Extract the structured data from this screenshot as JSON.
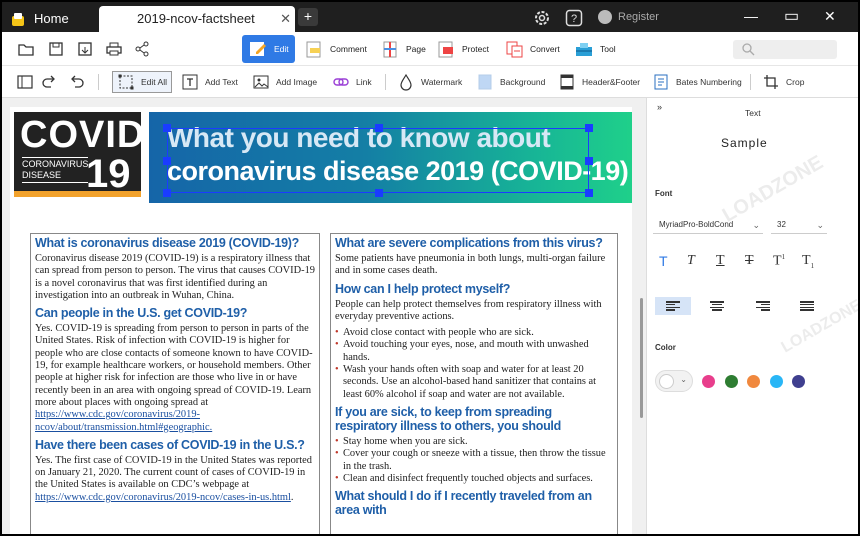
{
  "titlebar": {
    "home_tab": "Home",
    "doc_tab": "2019-ncov-factsheet",
    "close": "✕",
    "add": "+",
    "register": "Register",
    "minimize": "—",
    "maximize": "▭",
    "window_close": "✕"
  },
  "toolbar": {
    "tools": [
      "Edit",
      "Comment",
      "Page",
      "Protect",
      "Convert",
      "Tool"
    ]
  },
  "edit_toolbar": {
    "items": [
      "Edit All",
      "Add Text",
      "Add Image",
      "Link",
      "Watermark",
      "Background",
      "Header&Footer",
      "Bates Numbering",
      "Crop"
    ]
  },
  "document": {
    "logo_covid": "COVID",
    "logo_corona": "CORONAVIRUS",
    "logo_disease": "DISEASE",
    "logo_19": "19",
    "banner_line1": "What you need to know about",
    "banner_line2": "coronavirus disease 2019 (COVID-19)",
    "left": {
      "h1": "What is coronavirus disease 2019 (COVID-19)?",
      "p1": "Coronavirus disease 2019 (COVID-19) is a respiratory illness that can spread from person to person. The virus that causes COVID-19 is a novel coronavirus that was first identified during an investigation into an outbreak in Wuhan, China.",
      "h2": "Can people in the U.S. get COVID-19?",
      "p2": "Yes. COVID-19 is spreading from person to person in parts of the United States. Risk of infection with COVID-19 is higher for people who are close contacts of someone known to have COVID-19, for example healthcare workers, or household members. Other people at higher risk for infection are those who live in or have recently been in an area with ongoing spread of COVID-19. Learn more about places with ongoing spread at",
      "link1": "https://www.cdc.gov/coronavirus/2019-ncov/about/transmission.html#geographic.",
      "h3": "Have there been cases of COVID-19 in the U.S.?",
      "p3": "Yes. The first case of COVID-19 in the United States was reported on January 21, 2020. The current count of cases of COVID-19 in the United States is available on CDC’s webpage at",
      "link2": "https://www.cdc.gov/coronavirus/2019-ncov/cases-in-us.html",
      "link2_suffix": "."
    },
    "right": {
      "h1": "What are severe complications from this virus?",
      "p1": "Some patients have pneumonia in both lungs, multi-organ failure and in some cases death.",
      "h2": "How can I help protect myself?",
      "p2": "People can help protect themselves from respiratory illness with everyday preventive actions.",
      "list1": [
        "Avoid close contact with people who are sick.",
        "Avoid touching your eyes, nose, and mouth with unwashed hands.",
        "Wash your hands often with soap and water for at least 20 seconds. Use an alcohol-based hand sanitizer that contains at least 60% alcohol if soap and water are not available."
      ],
      "h3": "If you are sick, to keep from spreading respiratory illness to others, you should",
      "list2": [
        "Stay home when you are sick.",
        "Cover your cough or sneeze with a tissue, then throw the tissue in the trash.",
        "Clean and disinfect frequently touched objects and surfaces."
      ],
      "h4": "What should I do if I recently traveled from an area with"
    }
  },
  "panel": {
    "collapse": "»",
    "section_text": "Text",
    "sample": "Sample",
    "font_label": "Font",
    "font_value": "MyriadPro-BoldCond",
    "size_value": "32",
    "styles": [
      "T",
      "T",
      "T",
      "T",
      "T",
      "T"
    ],
    "color_label": "Color",
    "watermark": "LOADZONE",
    "colors": [
      "#e83e8c",
      "#2e7d32",
      "#f0883e",
      "#29b6f6",
      "#3f3f8f"
    ]
  }
}
